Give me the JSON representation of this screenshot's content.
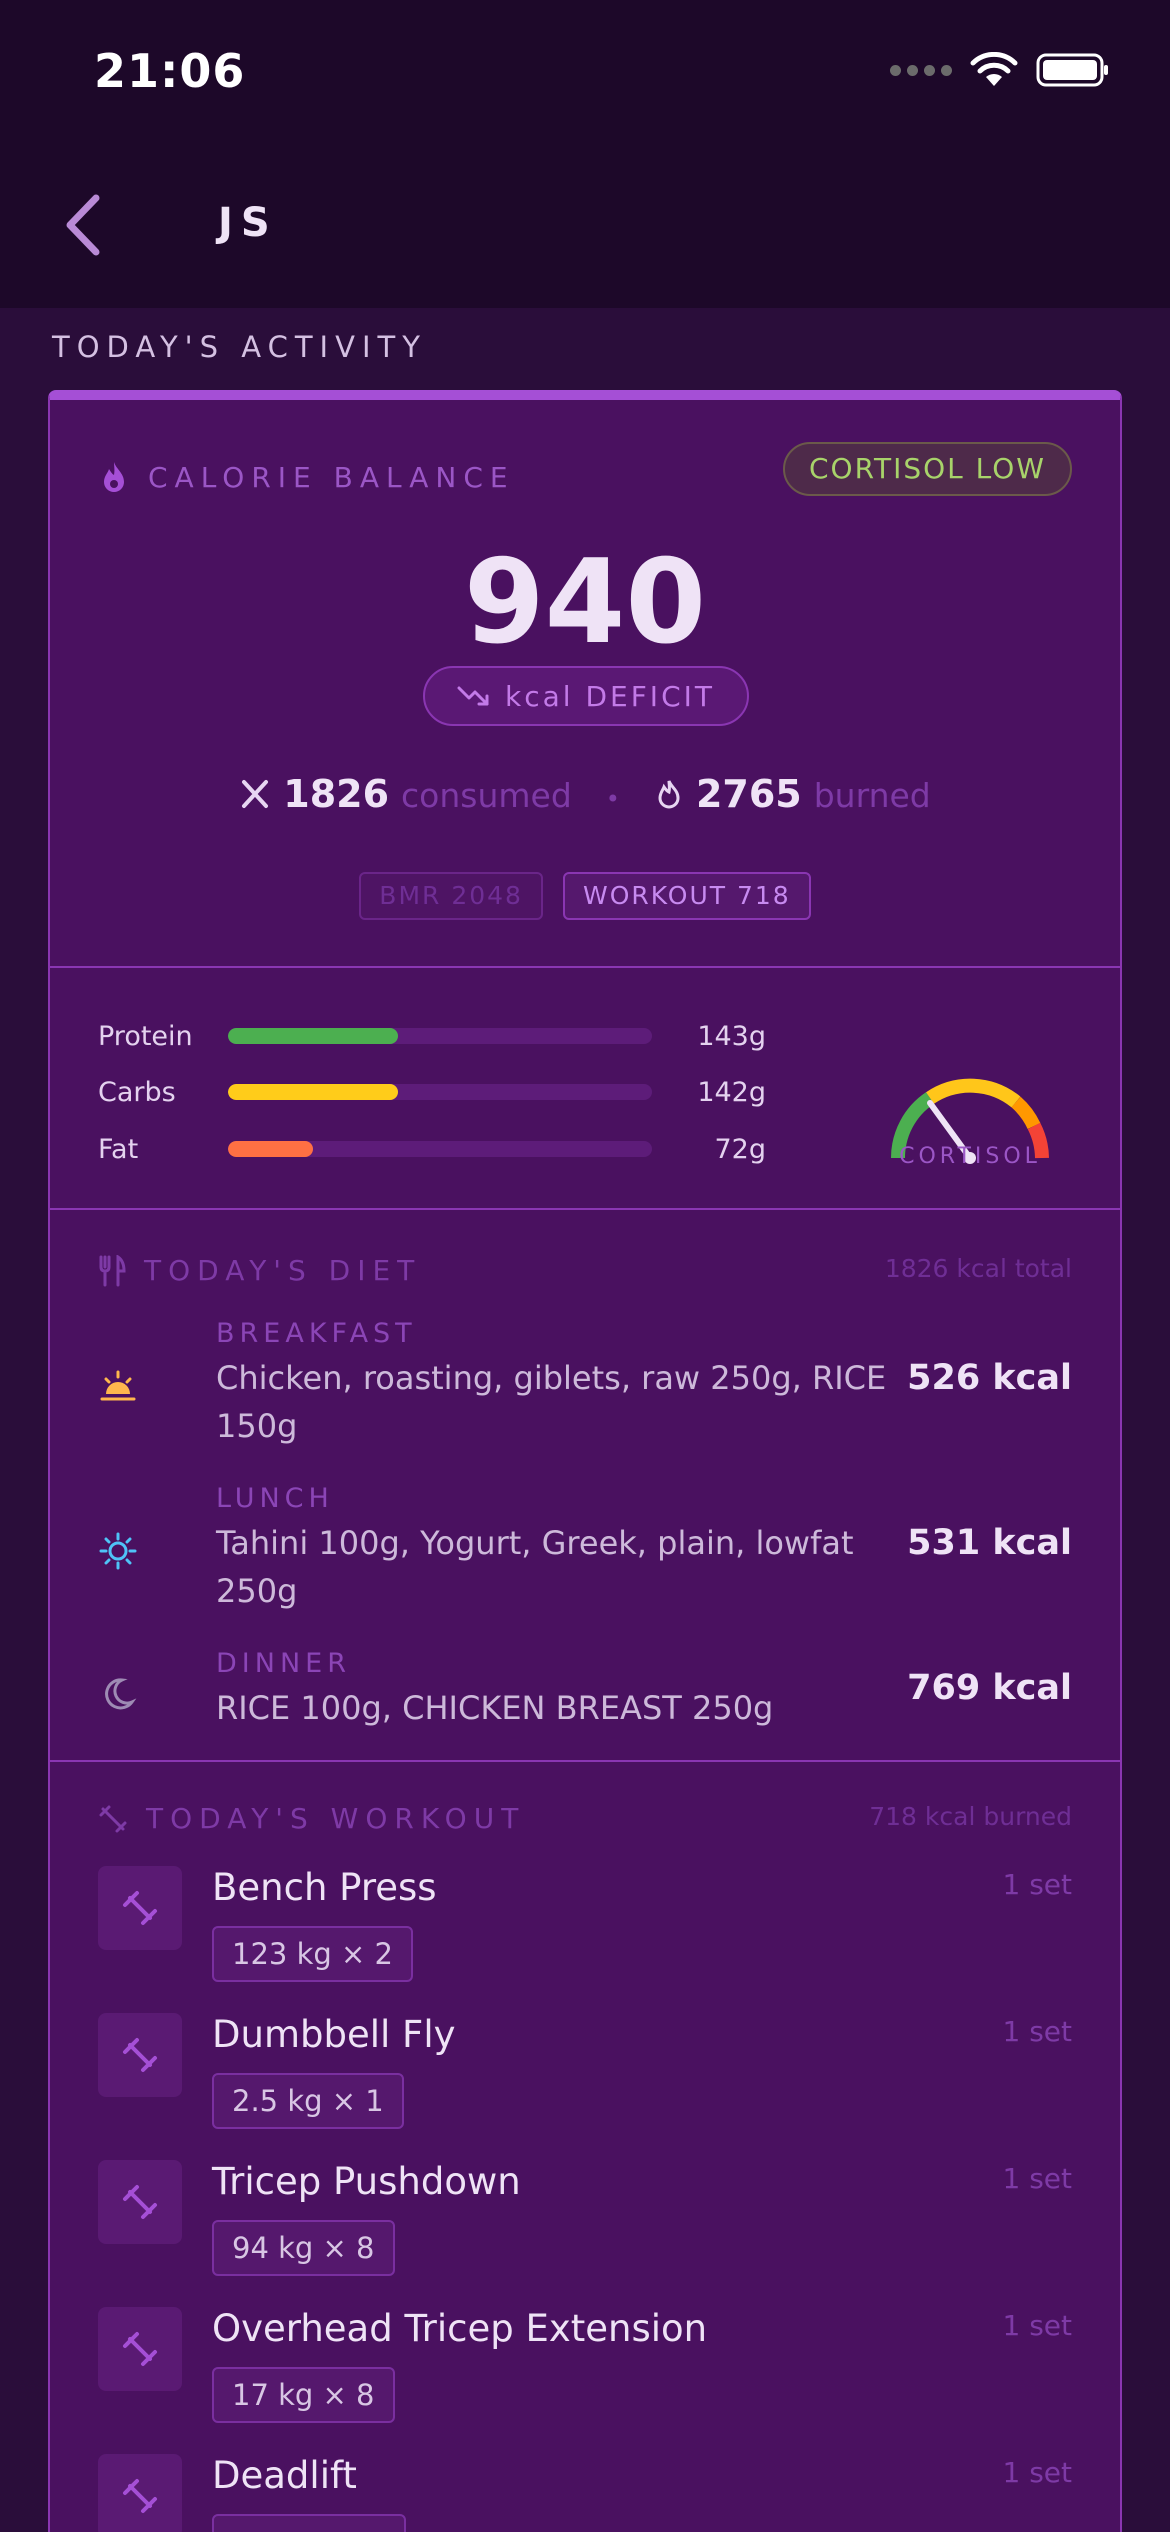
{
  "status_bar": {
    "time": "21:06"
  },
  "nav": {
    "title": "JS"
  },
  "section_label": "TODAY'S ACTIVITY",
  "calorie_balance": {
    "label": "CALORIE BALANCE",
    "cortisol_badge": "CORTISOL LOW",
    "net_kcal": "940",
    "deficit_label": "kcal DEFICIT",
    "consumed_value": "1826",
    "consumed_label": "consumed",
    "burned_value": "2765",
    "burned_label": "burned",
    "bmr_chip": "BMR 2048",
    "workout_chip": "WORKOUT 718"
  },
  "macros": {
    "items": [
      {
        "name": "Protein",
        "value": "143g",
        "fill_fraction": 0.4,
        "color": "#4caf50"
      },
      {
        "name": "Carbs",
        "value": "142g",
        "fill_fraction": 0.4,
        "color": "#ffcc1a"
      },
      {
        "name": "Fat",
        "value": "72g",
        "fill_fraction": 0.2,
        "color": "#ff7043"
      }
    ],
    "gauge_label": "CORTISOL",
    "gauge_level": 0.3
  },
  "diet": {
    "label": "TODAY'S DIET",
    "total": "1826 kcal total",
    "meals": [
      {
        "type": "BREAKFAST",
        "items": "Chicken, roasting, giblets, raw 250g, RICE 150g",
        "kcal": "526 kcal",
        "icon": "sunrise-icon"
      },
      {
        "type": "LUNCH",
        "items": "Tahini 100g, Yogurt, Greek, plain, lowfat 250g",
        "kcal": "531 kcal",
        "icon": "sun-icon"
      },
      {
        "type": "DINNER",
        "items": "RICE 100g, CHICKEN BREAST 250g",
        "kcal": "769 kcal",
        "icon": "moon-icon"
      }
    ]
  },
  "workout": {
    "label": "TODAY'S WORKOUT",
    "total": "718 kcal burned",
    "exercises": [
      {
        "name": "Bench Press",
        "weight": "123 kg × 2",
        "sets": "1 set"
      },
      {
        "name": "Dumbbell Fly",
        "weight": "2.5 kg × 1",
        "sets": "1 set"
      },
      {
        "name": "Tricep Pushdown",
        "weight": "94 kg × 8",
        "sets": "1 set"
      },
      {
        "name": "Overhead Tricep Extension",
        "weight": "17 kg × 8",
        "sets": "1 set"
      },
      {
        "name": "Deadlift",
        "weight": "",
        "sets": "1 set"
      }
    ]
  },
  "colors": {
    "background": "#2a0d3a",
    "card": "#4a1160",
    "accent": "#a54fd6",
    "badge_text": "#a8d36a"
  }
}
